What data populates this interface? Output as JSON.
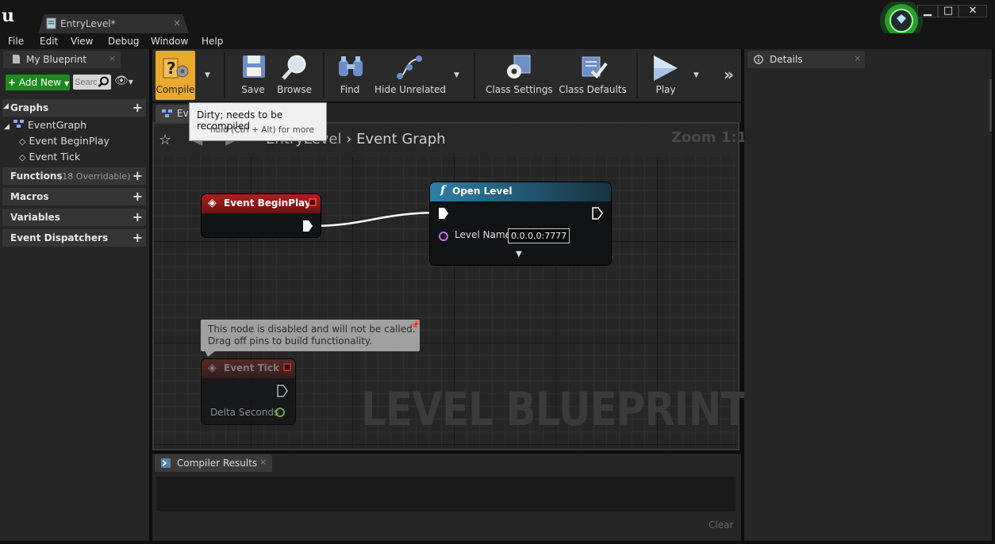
{
  "window": {
    "doc_tab_title": "EntryLevel*",
    "close_glyph": "×",
    "min_glyph": "▁",
    "max_glyph": "□",
    "win_close_glyph": "✕"
  },
  "menu": [
    "File",
    "Edit",
    "View",
    "Debug",
    "Window",
    "Help"
  ],
  "left_panel": {
    "tab_title": "My Blueprint",
    "add_new_label": "Add New",
    "search_placeholder": "Search",
    "sections": {
      "graphs": "Graphs",
      "functions": "Functions",
      "functions_note": "(18 Overridable)",
      "macros": "Macros",
      "variables": "Variables",
      "dispatchers": "Event Dispatchers"
    },
    "graph_items": [
      "EventGraph",
      "Event BeginPlay",
      "Event Tick"
    ]
  },
  "toolbar": {
    "compile": "Compile",
    "save": "Save",
    "browse": "Browse",
    "find": "Find",
    "hide_unrelated": "Hide Unrelated",
    "class_settings": "Class Settings",
    "class_defaults": "Class Defaults",
    "play": "Play"
  },
  "tooltip": {
    "title": "Dirty; needs to be recompiled",
    "hint": "hold (Ctrl + Alt) for more"
  },
  "graph": {
    "tab_label": "Ev",
    "breadcrumb_parent": "EntryLevel",
    "breadcrumb_current": "Event Graph",
    "zoom": "Zoom 1:1",
    "watermark": "LEVEL BLUEPRINT"
  },
  "nodes": {
    "begin_play": {
      "title": "Event BeginPlay"
    },
    "open_level": {
      "title": "Open Level",
      "pin_label": "Level Name",
      "pin_value": "0.0.0.0:7777"
    },
    "event_tick": {
      "title": "Event Tick",
      "pin_label": "Delta Seconds"
    },
    "comment": {
      "line1": "This node is disabled and will not be called.",
      "line2": "Drag off pins to build functionality."
    }
  },
  "compiler": {
    "tab_title": "Compiler Results",
    "clear_label": "Clear"
  },
  "details": {
    "tab_title": "Details"
  },
  "colors": {
    "compile_dirty": "#e8a92d",
    "add_new_green": "#1f8a1f",
    "event_red": "#9b1a1a",
    "function_blue": "#1f5f7a",
    "exec_wire": "#ffffff"
  },
  "icons": [
    "ue-logo-icon",
    "blueprint-doc-icon",
    "notification-icon",
    "compile-icon",
    "save-icon",
    "browse-icon",
    "find-icon",
    "hide-unrelated-icon",
    "class-settings-icon",
    "class-defaults-icon",
    "play-icon",
    "star-icon",
    "search-icon",
    "eye-icon"
  ]
}
